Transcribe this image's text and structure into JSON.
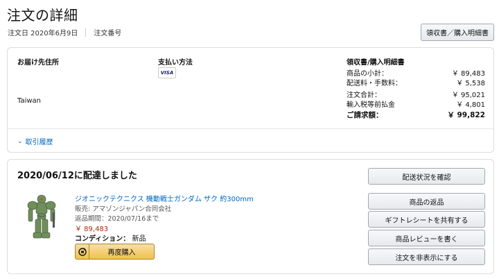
{
  "header": {
    "title": "注文の詳細",
    "order_date": "注文日 2020年6月9日",
    "order_number_label": "注文番号",
    "receipt_button": "領収書／購入明細書"
  },
  "order_info": {
    "shipping_label": "お届け先住所",
    "shipping_country": "Taiwan",
    "payment_label": "支払い方法",
    "payment_card": "VISA",
    "summary_label": "領収書/購入明細書",
    "summary": [
      {
        "label": "商品の小計：",
        "value": "￥ 89,483"
      },
      {
        "label": "配送料・手数料：",
        "value": "￥ 5,538"
      },
      {
        "label": "注文合計：",
        "value": "￥ 95,021"
      },
      {
        "label": "輸入税等前払金",
        "value": "￥ 4,801"
      }
    ],
    "total_label": "ご請求額：",
    "total_value": "￥ 99,822",
    "history_link": "取引履歴"
  },
  "shipment": {
    "title": "2020/06/12に配達しました",
    "product_name": "ジオニックテクニクス 機動戦士ガンダム ザク 約300mm",
    "seller": "販売: アマゾンジャパン合同会社",
    "return_period": "返品期間：2020/07/16まで",
    "price": "￥ 89,483",
    "condition_label": "コンディション：",
    "condition_value": "新品",
    "buy_again": "再度購入",
    "actions": [
      "配送状況を確認",
      "商品の返品",
      "ギフトレシートを共有する",
      "商品レビューを書く",
      "注文を非表示にする"
    ]
  },
  "colors": {
    "link": "#0066c0",
    "price": "#b12704",
    "buy_again_bg": "#f0c14b",
    "visa_blue": "#1a1f71",
    "zaku_green": "#6f8f5a"
  }
}
